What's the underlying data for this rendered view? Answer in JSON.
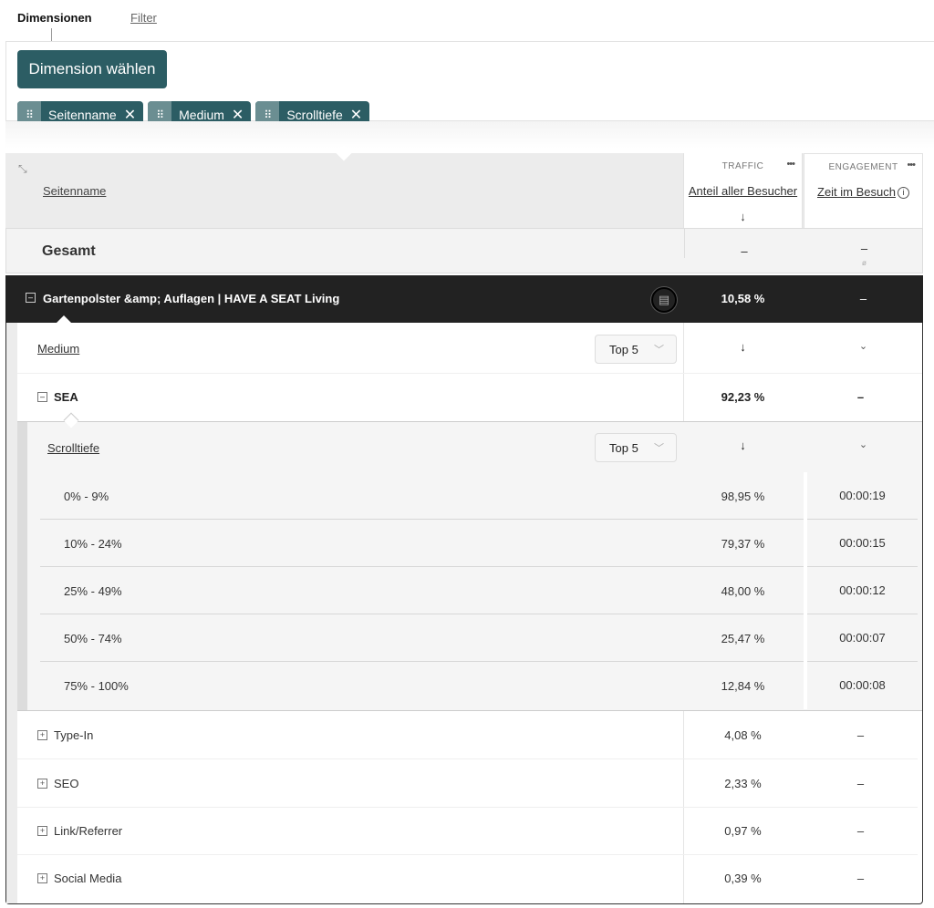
{
  "tabs": {
    "dimensions": "Dimensionen",
    "filter": "Filter"
  },
  "panel": {
    "choose_button": "Dimension wählen",
    "chips": [
      {
        "label": "Seitenname",
        "handle": "⠿",
        "close": "✕"
      },
      {
        "label": "Medium",
        "handle": "⠿",
        "close": "✕"
      },
      {
        "label": "Scrolltiefe",
        "handle": "⠿",
        "close": "✕"
      }
    ]
  },
  "table": {
    "dimension_header": "Seitenname",
    "groups": {
      "traffic": "TRAFFIC",
      "engagement": "ENGAGEMENT",
      "more": "•••"
    },
    "metrics": {
      "share": "Anteil aller Besucher",
      "time": "Zeit im Besuch",
      "info": "i",
      "sort": "↓"
    },
    "total": {
      "label": "Gesamt",
      "traffic": "–",
      "engagement": "–",
      "avg_symbol": "ø"
    },
    "page_row": {
      "label": "Gartenpolster &amp; Auflagen | HAVE A SEAT Living",
      "traffic": "10,58 %",
      "engagement": "–",
      "minus": "–",
      "doc": "▤"
    },
    "medium_sub": {
      "title": "Medium",
      "top": "Top 5",
      "chev": "﹀",
      "sort": "↓",
      "expand": "⌄"
    },
    "sea_row": {
      "label": "SEA",
      "traffic": "92,23 %",
      "engagement": "–",
      "minus": "–"
    },
    "scroll_sub": {
      "title": "Scrolltiefe",
      "top": "Top 5",
      "chev": "﹀",
      "sort": "↓",
      "expand": "⌄"
    },
    "scroll_rows": [
      {
        "label": "0% - 9%",
        "traffic": "98,95 %",
        "time": "00:00:19"
      },
      {
        "label": "10% - 24%",
        "traffic": "79,37 %",
        "time": "00:00:15"
      },
      {
        "label": "25% - 49%",
        "traffic": "48,00 %",
        "time": "00:00:12"
      },
      {
        "label": "50% - 74%",
        "traffic": "25,47 %",
        "time": "00:00:07"
      },
      {
        "label": "75% - 100%",
        "traffic": "12,84 %",
        "time": "00:00:08"
      }
    ],
    "medium_rows": [
      {
        "label": "Type-In",
        "traffic": "4,08 %",
        "time": "–",
        "plus": "+"
      },
      {
        "label": "SEO",
        "traffic": "2,33 %",
        "time": "–",
        "plus": "+"
      },
      {
        "label": "Link/Referrer",
        "traffic": "0,97 %",
        "time": "–",
        "plus": "+"
      },
      {
        "label": "Social Media",
        "traffic": "0,39 %",
        "time": "–",
        "plus": "+"
      }
    ]
  },
  "colors": {
    "accent": "#2c5d64",
    "chip_handle": "#6b8e92",
    "dark_row": "#222222"
  }
}
